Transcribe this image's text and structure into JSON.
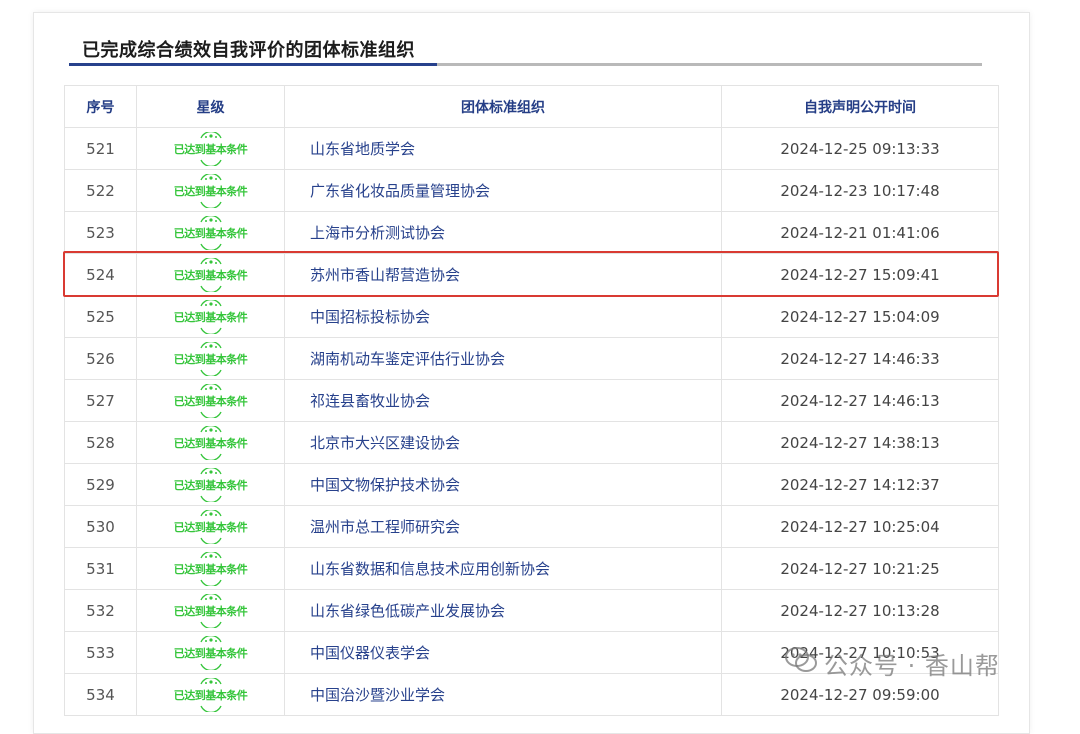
{
  "section": {
    "title": "已完成综合绩效自我评价的团体标准组织"
  },
  "table": {
    "headers": [
      "序号",
      "星级",
      "团体标准组织",
      "自我声明公开时间"
    ],
    "badge_text": "已达到基本条件",
    "rows": [
      {
        "num": "521",
        "org": "山东省地质学会",
        "time": "2024-12-25 09:13:33"
      },
      {
        "num": "522",
        "org": "广东省化妆品质量管理协会",
        "time": "2024-12-23 10:17:48"
      },
      {
        "num": "523",
        "org": "上海市分析测试协会",
        "time": "2024-12-21 01:41:06"
      },
      {
        "num": "524",
        "org": "苏州市香山帮营造协会",
        "time": "2024-12-27 15:09:41"
      },
      {
        "num": "525",
        "org": "中国招标投标协会",
        "time": "2024-12-27 15:04:09"
      },
      {
        "num": "526",
        "org": "湖南机动车鉴定评估行业协会",
        "time": "2024-12-27 14:46:33"
      },
      {
        "num": "527",
        "org": "祁连县畜牧业协会",
        "time": "2024-12-27 14:46:13"
      },
      {
        "num": "528",
        "org": "北京市大兴区建设协会",
        "time": "2024-12-27 14:38:13"
      },
      {
        "num": "529",
        "org": "中国文物保护技术协会",
        "time": "2024-12-27 14:12:37"
      },
      {
        "num": "530",
        "org": "温州市总工程师研究会",
        "time": "2024-12-27 10:25:04"
      },
      {
        "num": "531",
        "org": "山东省数据和信息技术应用创新协会",
        "time": "2024-12-27 10:21:25"
      },
      {
        "num": "532",
        "org": "山东省绿色低碳产业发展协会",
        "time": "2024-12-27 10:13:28"
      },
      {
        "num": "533",
        "org": "中国仪器仪表学会",
        "time": "2024-12-27 10:10:53"
      },
      {
        "num": "534",
        "org": "中国治沙暨沙业学会",
        "time": "2024-12-27 09:59:00"
      }
    ]
  },
  "watermark": {
    "text": "公众号 · 香山帮",
    "icon": "wechat-icon"
  },
  "colors": {
    "title_rule": "#27418c",
    "link": "#27418c",
    "badge": "#35c53b",
    "highlight": "#d93a32"
  }
}
